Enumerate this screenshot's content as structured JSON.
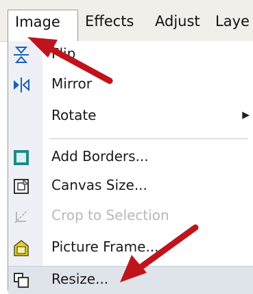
{
  "menubar": {
    "image": "Image",
    "effects": "Effects",
    "adjust": "Adjust",
    "layers": "Laye"
  },
  "menu": {
    "flip": "Flip",
    "mirror": "Mirror",
    "rotate": "Rotate",
    "add_borders": "Add Borders...",
    "canvas_size": "Canvas Size...",
    "crop": "Crop to Selection",
    "picture_frame": "Picture Frame...",
    "resize": "Resize..."
  },
  "icons": {
    "flip": "flip-vertical-icon",
    "mirror": "mirror-icon",
    "rotate_arrow": "submenu-arrow",
    "add_borders": "border-icon",
    "canvas_size": "canvas-icon",
    "crop": "crop-icon",
    "picture_frame": "frame-icon",
    "resize": "resize-icon"
  },
  "colors": {
    "annotation_arrow": "#c0141c",
    "highlight": "#dfe3ea",
    "icon_blue": "#1b5fb4",
    "frame_yellow": "#e6cf3c"
  }
}
